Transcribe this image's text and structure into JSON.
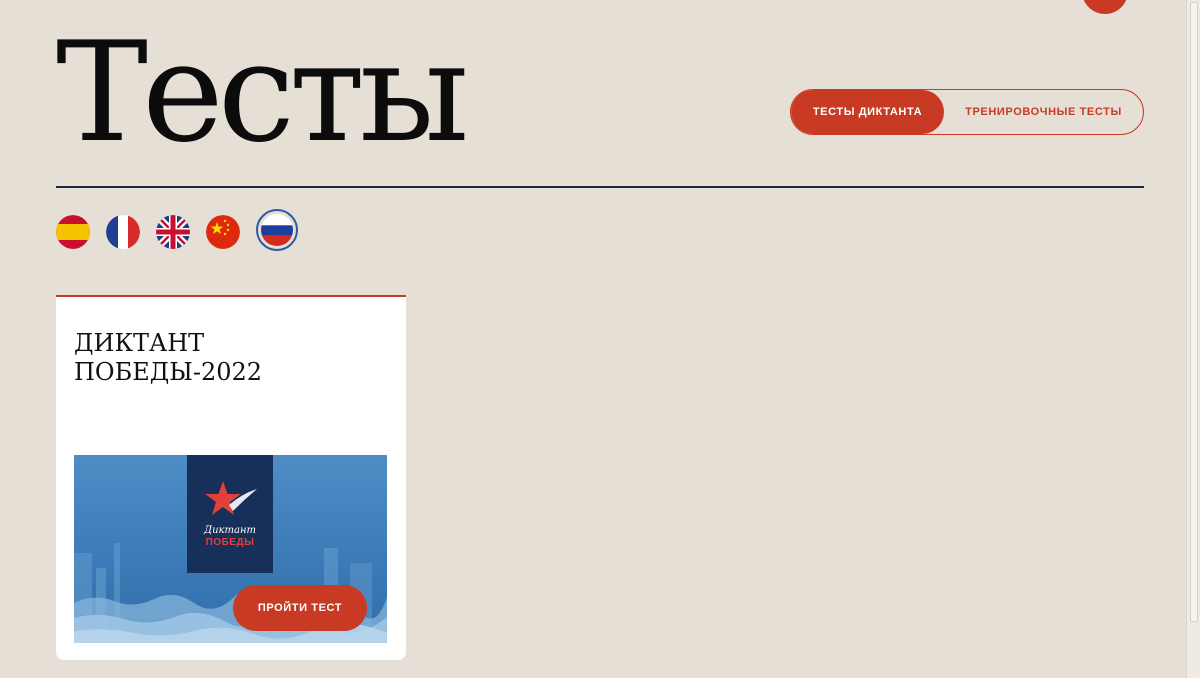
{
  "header": {
    "title": "Тесты"
  },
  "tabs": [
    {
      "label": "Тесты диктанта",
      "active": true
    },
    {
      "label": "Тренировочные тесты",
      "active": false
    }
  ],
  "languages": [
    {
      "icon": "spain-flag-icon",
      "selected": false
    },
    {
      "icon": "france-flag-icon",
      "selected": false
    },
    {
      "icon": "uk-flag-icon",
      "selected": false
    },
    {
      "icon": "china-flag-icon",
      "selected": false
    },
    {
      "icon": "russia-flag-icon",
      "selected": true
    }
  ],
  "card": {
    "title": "Диктант Победы-2022",
    "logo_line1": "Диктант",
    "logo_line2": "ПОБЕДЫ",
    "button_label": "Пройти тест"
  },
  "colors": {
    "accent": "#c93a24",
    "background": "#e6dfd6",
    "divider": "#1c2a44",
    "logo_bg": "#17305a"
  }
}
